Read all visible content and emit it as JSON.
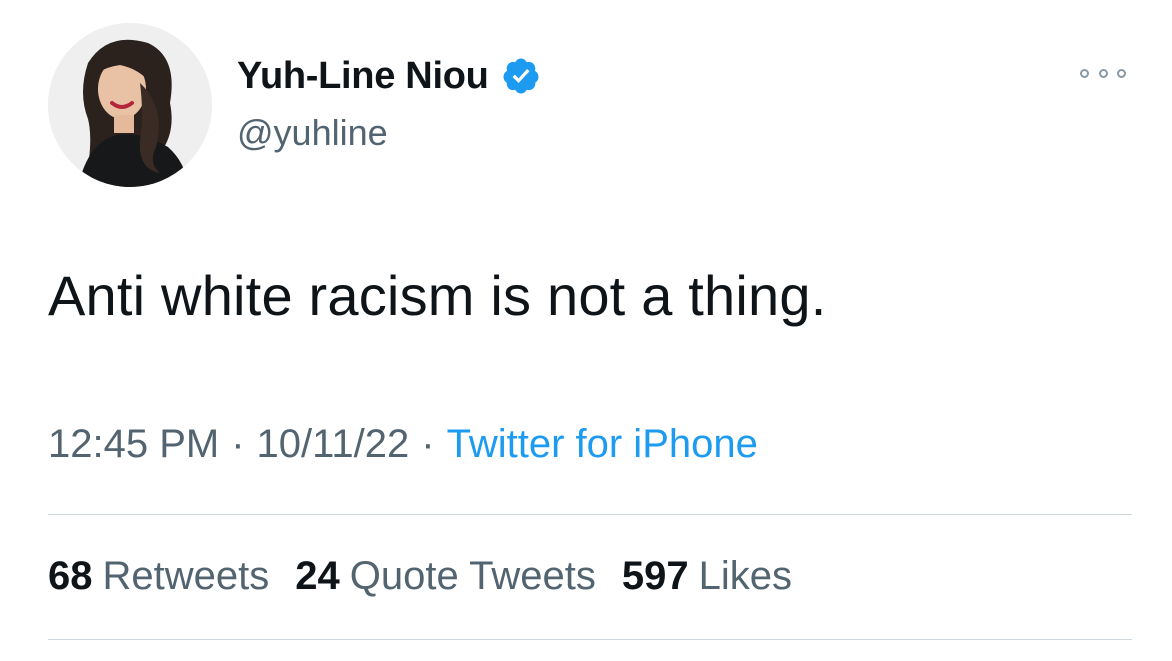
{
  "author": {
    "display_name": "Yuh-Line Niou",
    "handle": "@yuhline",
    "verified": true
  },
  "tweet": {
    "text": "Anti white racism is not a thing.",
    "time": "12:45 PM",
    "date": "10/11/22",
    "separator": "·",
    "source": "Twitter for iPhone"
  },
  "stats": {
    "retweets_count": "68",
    "retweets_label": "Retweets",
    "quotes_count": "24",
    "quotes_label": "Quote Tweets",
    "likes_count": "597",
    "likes_label": "Likes"
  },
  "colors": {
    "text_primary": "#0f1419",
    "text_secondary": "#536471",
    "link": "#1d9bf0",
    "verified_badge": "#1d9bf0",
    "divider": "#cfd9de"
  },
  "icons": {
    "verified": "verified-badge-icon",
    "more": "more-options-icon"
  }
}
